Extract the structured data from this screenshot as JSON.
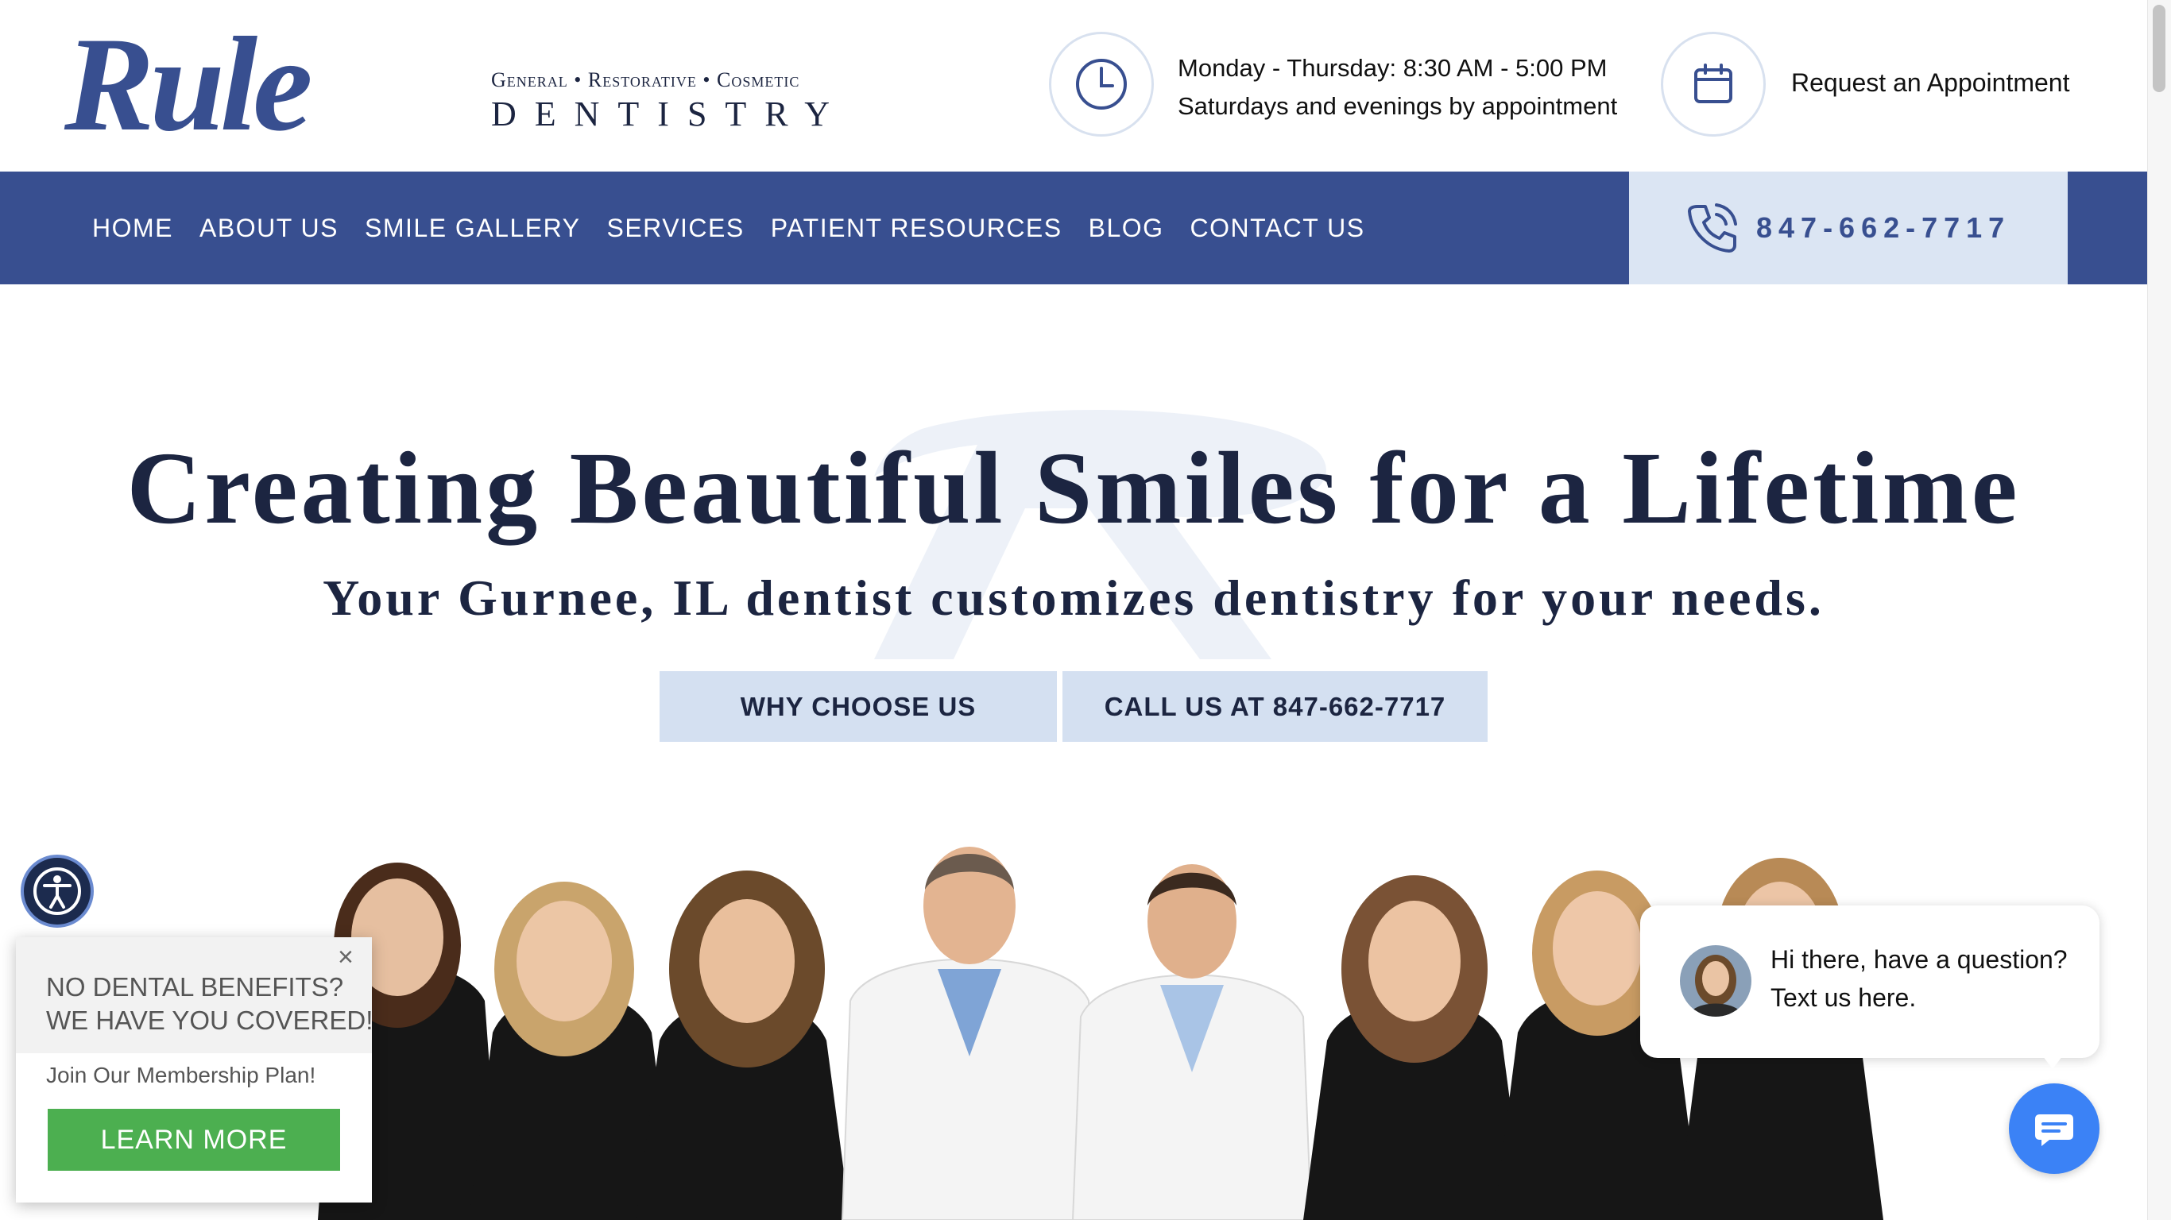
{
  "brand": {
    "logo_text": "Rule",
    "tagline_top": "General • Restorative • Cosmetic",
    "tagline_bottom": "DENTISTRY",
    "color_primary": "#384f90",
    "color_light": "#d4e0f1"
  },
  "header": {
    "hours_line1": "Monday - Thursday: 8:30 AM - 5:00 PM",
    "hours_line2": "Saturdays and evenings by appointment",
    "appointment_label": "Request an Appointment",
    "clock_icon": "clock-icon",
    "calendar_icon": "calendar-icon"
  },
  "nav": {
    "items": [
      "HOME",
      "ABOUT US",
      "SMILE GALLERY",
      "SERVICES",
      "PATIENT RESOURCES",
      "BLOG",
      "CONTACT US"
    ],
    "phone": "847-662-7717",
    "phone_icon": "phone-icon"
  },
  "hero": {
    "title": "Creating Beautiful Smiles for a Lifetime",
    "subtitle": "Your Gurnee, IL dentist customizes dentistry for your needs.",
    "btn_why": "WHY CHOOSE US",
    "btn_call": "CALL US AT 847-662-7717"
  },
  "promo": {
    "heading1": "NO DENTAL BENEFITS?",
    "heading2": "WE HAVE YOU COVERED!",
    "text": "Join Our Membership Plan!",
    "button": "LEARN MORE",
    "close": "×",
    "button_color": "#4caf50"
  },
  "chat": {
    "message": "Hi there, have a question? Text us here.",
    "launcher_color": "#3b82f6"
  }
}
